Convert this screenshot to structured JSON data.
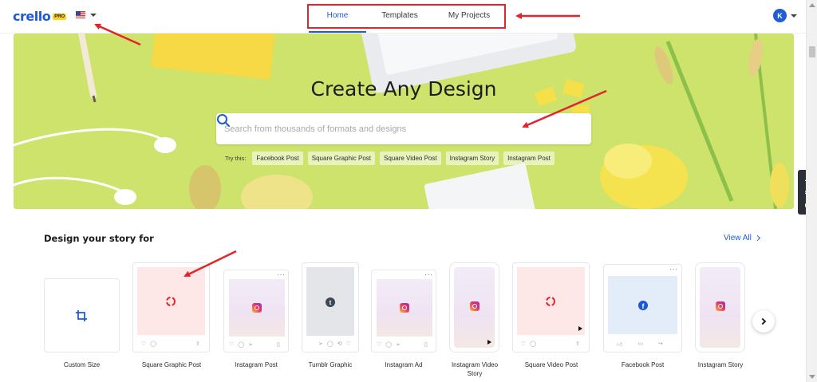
{
  "header": {
    "logo_text": "crello",
    "logo_badge": "PRO",
    "language_icon": "us-flag-icon",
    "nav": [
      {
        "label": "Home",
        "active": true
      },
      {
        "label": "Templates",
        "active": false
      },
      {
        "label": "My Projects",
        "active": false
      }
    ],
    "avatar_initial": "K"
  },
  "hero": {
    "title": "Create Any Design",
    "search_placeholder": "Search from thousands of formats and designs",
    "try_label": "Try this:",
    "suggestions": [
      "Facebook Post",
      "Square Graphic Post",
      "Square Video Post",
      "Instagram Story",
      "Instagram Post"
    ]
  },
  "section": {
    "title": "Design your story for",
    "view_all": "View All"
  },
  "formats": [
    {
      "label": "Custom Size"
    },
    {
      "label": "Square Graphic Post"
    },
    {
      "label": "Instagram Post"
    },
    {
      "label": "Tumblr Graphic"
    },
    {
      "label": "Instagram Ad"
    },
    {
      "label": "Instagram Video Story"
    },
    {
      "label": "Square Video Post"
    },
    {
      "label": "Facebook Post"
    },
    {
      "label": "Instagram Story"
    }
  ],
  "feedback_label": "Feedback",
  "colors": {
    "accent": "#1f5bd6",
    "hero_bg": "#cde36b",
    "annotation_red": "#e2252b"
  }
}
